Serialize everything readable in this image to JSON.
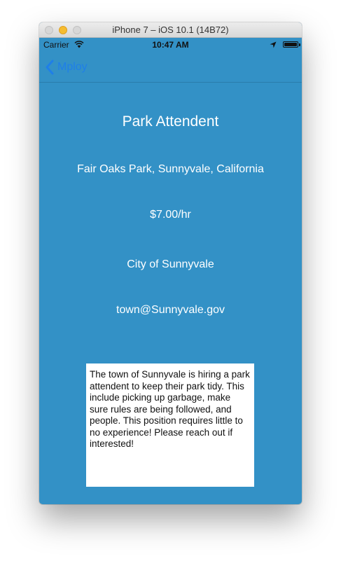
{
  "simulator": {
    "window_title": "iPhone 7 – iOS 10.1 (14B72)"
  },
  "status_bar": {
    "carrier": "Carrier",
    "time": "10:47 AM"
  },
  "nav": {
    "back_label": "Mploy"
  },
  "job": {
    "title": "Park Attendent",
    "location": "Fair Oaks Park, Sunnyvale, California",
    "pay": "$7.00/hr",
    "employer": "City of Sunnyvale",
    "email": "town@Sunnyvale.gov",
    "description": "The town of Sunnyvale is hiring a park attendent to keep their park tidy. This include picking up garbage, make sure rules are being followed, and people. This position requires little to no experience! Please reach out if interested!"
  },
  "colors": {
    "background": "#3391c6",
    "tint": "#1f7fe8",
    "text": "#ffffff"
  },
  "icons": [
    "wifi-icon",
    "location-arrow-icon",
    "battery-icon",
    "chevron-left-icon"
  ]
}
